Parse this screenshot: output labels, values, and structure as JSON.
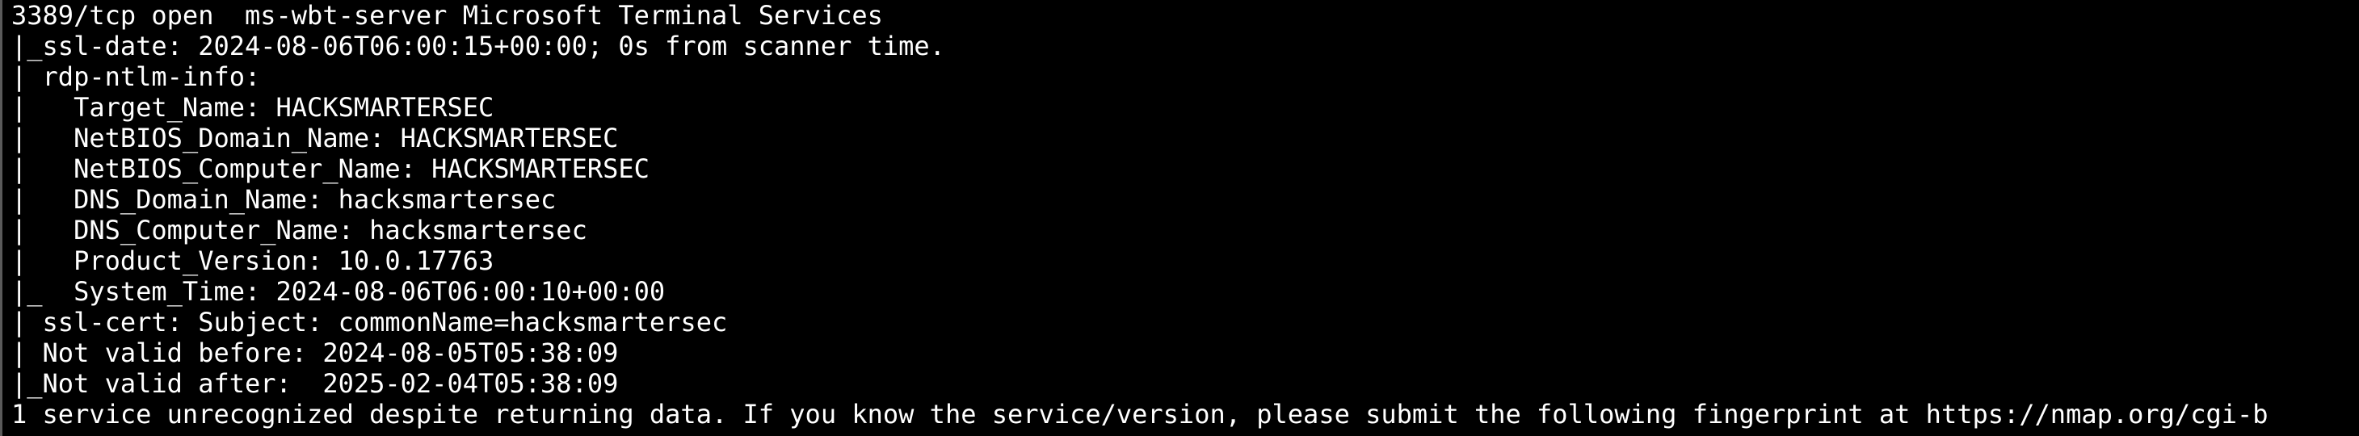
{
  "terminal": {
    "lines": [
      "3389/tcp open  ms-wbt-server Microsoft Terminal Services",
      "|_ssl-date: 2024-08-06T06:00:15+00:00; 0s from scanner time.",
      "| rdp-ntlm-info:",
      "|   Target_Name: HACKSMARTERSEC",
      "|   NetBIOS_Domain_Name: HACKSMARTERSEC",
      "|   NetBIOS_Computer_Name: HACKSMARTERSEC",
      "|   DNS_Domain_Name: hacksmartersec",
      "|   DNS_Computer_Name: hacksmartersec",
      "|   Product_Version: 10.0.17763",
      "|_  System_Time: 2024-08-06T06:00:10+00:00",
      "| ssl-cert: Subject: commonName=hacksmartersec",
      "| Not valid before: 2024-08-05T05:38:09",
      "|_Not valid after:  2025-02-04T05:38:09",
      "1 service unrecognized despite returning data. If you know the service/version, please submit the following fingerprint at https://nmap.org/cgi-b"
    ],
    "colors": {
      "background": "#000000",
      "text": "#ffffff"
    }
  }
}
